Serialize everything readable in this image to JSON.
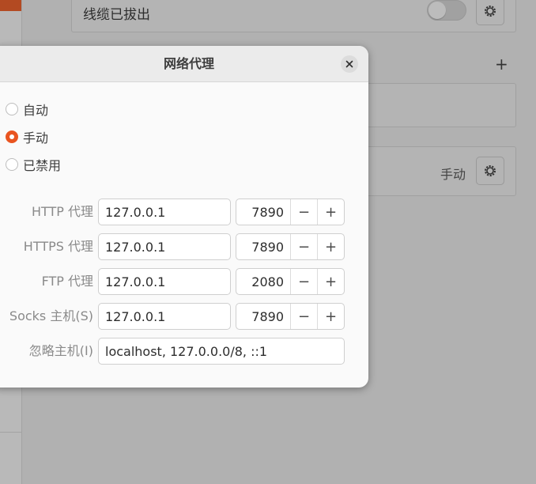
{
  "background": {
    "wired_row_label": "线缆已拔出",
    "proxy_status": "手动",
    "add_icon": "plus-icon",
    "gear_icon": "gear-icon"
  },
  "dialog": {
    "title": "网络代理",
    "close_icon": "close-icon",
    "modes": [
      {
        "label": "自动",
        "checked": false
      },
      {
        "label": "手动",
        "checked": true
      },
      {
        "label": "已禁用",
        "checked": false
      }
    ],
    "http": {
      "label": "HTTP 代理",
      "host": "127.0.0.1",
      "port": "7890"
    },
    "https": {
      "label": "HTTPS 代理",
      "host": "127.0.0.1",
      "port": "7890"
    },
    "ftp": {
      "label": "FTP 代理",
      "host": "127.0.0.1",
      "port": "2080"
    },
    "socks": {
      "label": "Socks 主机(S)",
      "host": "127.0.0.1",
      "port": "7890"
    },
    "ignore": {
      "label": "忽略主机(I)",
      "value": "localhost, 127.0.0.0/8, ::1"
    },
    "minus_symbol": "−",
    "plus_symbol": "+"
  },
  "colors": {
    "accent": "#e95420",
    "dim_overlay": "#b1b1b1",
    "dialog_bg": "#fafafa"
  }
}
